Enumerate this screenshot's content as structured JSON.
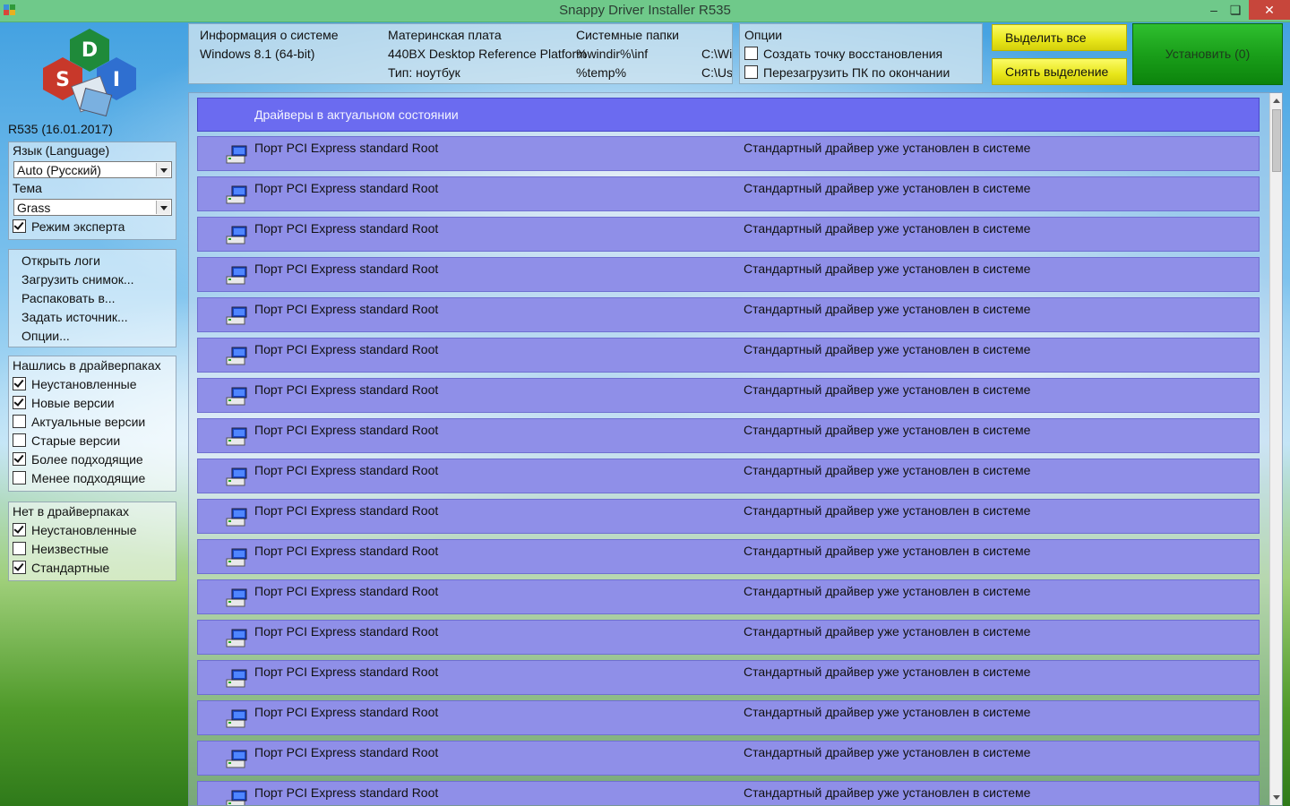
{
  "window": {
    "title": "Snappy Driver Installer R535",
    "min": "–",
    "max": "❏",
    "close": "✕"
  },
  "sidebar": {
    "version": "R535 (16.01.2017)",
    "language_label": "Язык (Language)",
    "language_value": "Auto (Русский)",
    "theme_label": "Тема",
    "theme_value": "Grass",
    "expert_mode": {
      "label": "Режим эксперта",
      "checked": true
    },
    "menu": [
      "Открыть логи",
      "Загрузить снимок...",
      "Распаковать в...",
      "Задать источник...",
      "Опции..."
    ],
    "found_header": "Нашлись в драйверпаках",
    "found": [
      {
        "label": "Неустановленные",
        "checked": true
      },
      {
        "label": "Новые версии",
        "checked": true
      },
      {
        "label": "Актуальные версии",
        "checked": false
      },
      {
        "label": "Старые версии",
        "checked": false
      },
      {
        "label": "Более подходящие",
        "checked": true
      },
      {
        "label": "Менее подходящие",
        "checked": false
      }
    ],
    "notfound_header": "Нет в драйверпаках",
    "notfound": [
      {
        "label": "Неустановленные",
        "checked": true
      },
      {
        "label": "Неизвестные",
        "checked": false
      },
      {
        "label": "Стандартные",
        "checked": true
      }
    ]
  },
  "info": {
    "sysinfo_label": "Информация о системе",
    "os": "Windows 8.1 (64-bit)",
    "mb_label": "Материнская плата",
    "mb_value": "440BX Desktop Reference Platform",
    "type": "Тип: ноутбук",
    "folders_label": "Системные папки",
    "folder1": "%windir%\\inf",
    "folder2": "%temp%",
    "path1": "C:\\Windows\\inf",
    "path2": "C:\\Users"
  },
  "options": {
    "label": "Опции",
    "restore_point": {
      "label": "Создать точку восстановления",
      "checked": false
    },
    "reboot": {
      "label": "Перезагрузить ПК по окончании",
      "checked": false
    }
  },
  "buttons": {
    "select_all": "Выделить все",
    "deselect": "Снять выделение",
    "install": "Установить (0)"
  },
  "list": {
    "header": "Драйверы в актуальном состоянии",
    "rows": [
      {
        "name": "Порт PCI Express standard Root",
        "status": "Стандартный драйвер уже установлен в системе"
      },
      {
        "name": "Порт PCI Express standard Root",
        "status": "Стандартный драйвер уже установлен в системе"
      },
      {
        "name": "Порт PCI Express standard Root",
        "status": "Стандартный драйвер уже установлен в системе"
      },
      {
        "name": "Порт PCI Express standard Root",
        "status": "Стандартный драйвер уже установлен в системе"
      },
      {
        "name": "Порт PCI Express standard Root",
        "status": "Стандартный драйвер уже установлен в системе"
      },
      {
        "name": "Порт PCI Express standard Root",
        "status": "Стандартный драйвер уже установлен в системе"
      },
      {
        "name": "Порт PCI Express standard Root",
        "status": "Стандартный драйвер уже установлен в системе"
      },
      {
        "name": "Порт PCI Express standard Root",
        "status": "Стандартный драйвер уже установлен в системе"
      },
      {
        "name": "Порт PCI Express standard Root",
        "status": "Стандартный драйвер уже установлен в системе"
      },
      {
        "name": "Порт PCI Express standard Root",
        "status": "Стандартный драйвер уже установлен в системе"
      },
      {
        "name": "Порт PCI Express standard Root",
        "status": "Стандартный драйвер уже установлен в системе"
      },
      {
        "name": "Порт PCI Express standard Root",
        "status": "Стандартный драйвер уже установлен в системе"
      },
      {
        "name": "Порт PCI Express standard Root",
        "status": "Стандартный драйвер уже установлен в системе"
      },
      {
        "name": "Порт PCI Express standard Root",
        "status": "Стандартный драйвер уже установлен в системе"
      },
      {
        "name": "Порт PCI Express standard Root",
        "status": "Стандартный драйвер уже установлен в системе"
      },
      {
        "name": "Порт PCI Express standard Root",
        "status": "Стандартный драйвер уже установлен в системе"
      },
      {
        "name": "Порт PCI Express standard Root",
        "status": "Стандартный драйвер уже установлен в системе"
      }
    ]
  },
  "icons": {
    "app": "sdi-app-icon",
    "logo": "sdi-logo",
    "device": "network-device-icon"
  },
  "colors": {
    "header_row": "#6b6bf0",
    "driver_row": "#8f8fe8",
    "titlebar": "#6fc98a",
    "install_button": "#1a9f1a",
    "yellow_button": "#e8e61a"
  }
}
